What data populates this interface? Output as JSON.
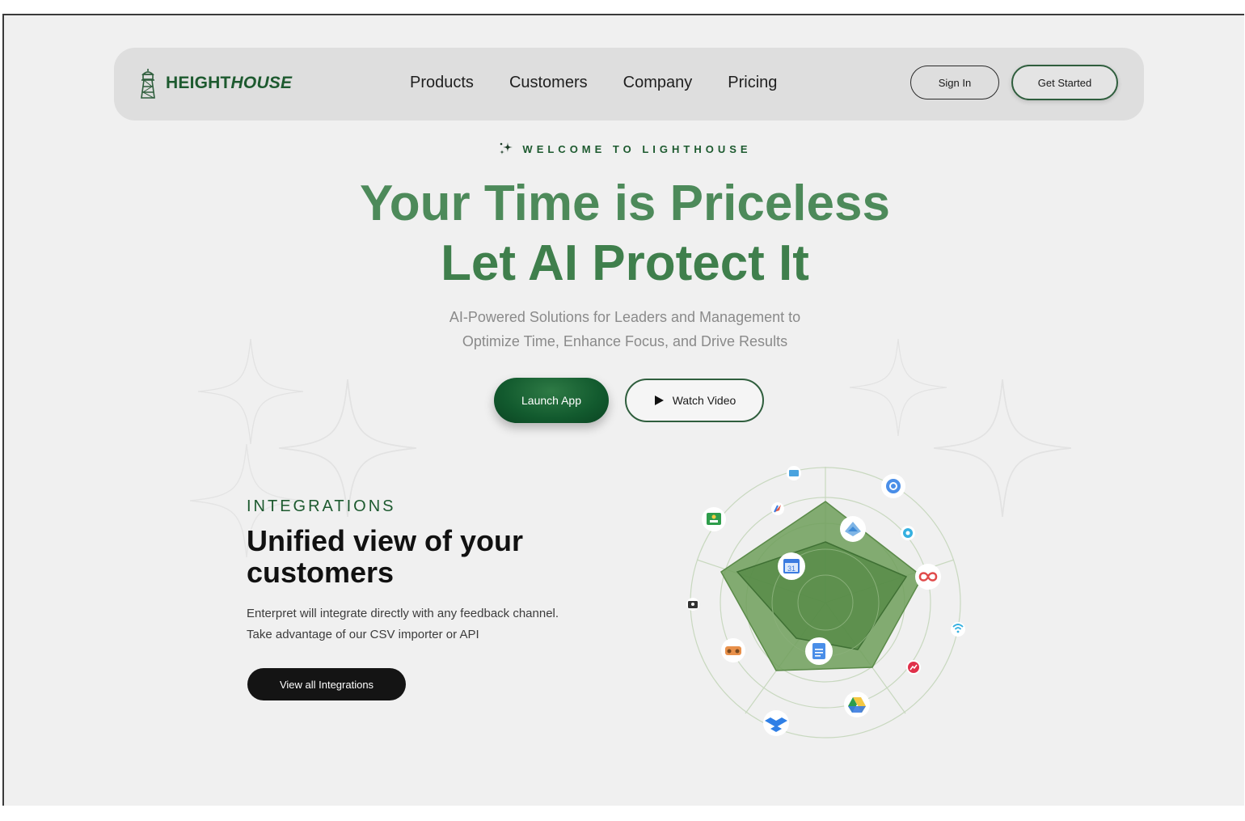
{
  "brand": {
    "name_part1": "HEIGHT",
    "name_part2": "HOUSE"
  },
  "nav": {
    "links": [
      "Products",
      "Customers",
      "Company",
      "Pricing"
    ],
    "sign_in": "Sign In",
    "get_started": "Get Started"
  },
  "hero": {
    "eyebrow": "WELCOME TO LIGHTHOUSE",
    "headline_line1": "Your Time is Priceless",
    "headline_line2": "Let AI Protect It",
    "subtitle_line1": "AI-Powered Solutions for Leaders and Management to",
    "subtitle_line2": "Optimize Time, Enhance Focus, and Drive Results",
    "launch_label": "Launch App",
    "video_label": "Watch Video"
  },
  "integrations": {
    "label": "INTEGRATIONS",
    "title": "Unified view of your customers",
    "desc_line1": "Enterpret will integrate directly with any feedback channel.",
    "desc_line2": "Take advantage of our CSV importer or API",
    "button": "View all Integrations",
    "icons": [
      "mail-icon",
      "google-icon",
      "classroom-icon",
      "feather-icon",
      "photos-icon",
      "meet-icon",
      "calendar-icon",
      "infinity-icon",
      "camera-icon",
      "wifi-icon",
      "docs-icon",
      "vr-icon",
      "chart-icon",
      "drive-icon",
      "dropbox-icon"
    ]
  },
  "colors": {
    "brand_green": "#1d5a2f",
    "accent_green": "#3f7f4c",
    "background": "#f0f0f0"
  }
}
